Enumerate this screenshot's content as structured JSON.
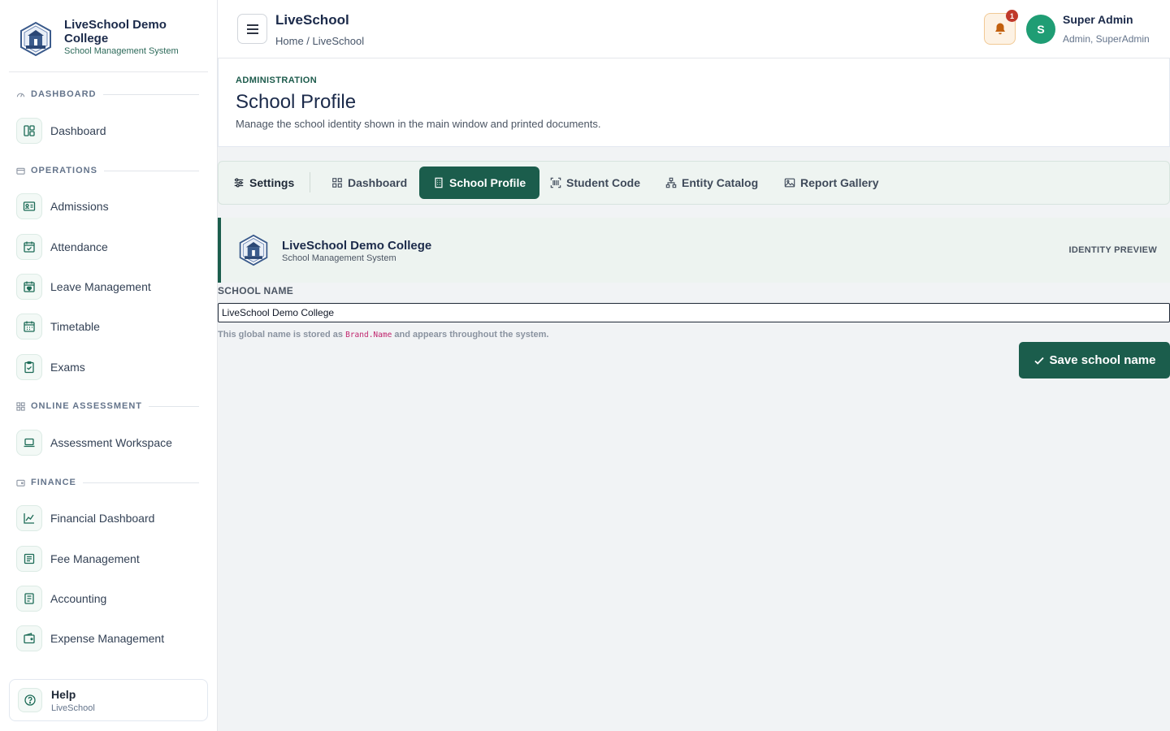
{
  "brand": {
    "name": "LiveSchool Demo College",
    "subtitle": "School Management System"
  },
  "sidebar": {
    "sections": [
      {
        "label": "DASHBOARD",
        "icon": "gauge-icon"
      },
      {
        "label": "OPERATIONS",
        "icon": "folder-icon"
      },
      {
        "label": "ONLINE ASSESSMENT",
        "icon": "grid-icon"
      },
      {
        "label": "FINANCE",
        "icon": "wallet-icon"
      }
    ],
    "items": [
      {
        "label": "Dashboard",
        "icon": "layout-icon"
      },
      {
        "label": "Admissions",
        "icon": "id-card-icon"
      },
      {
        "label": "Attendance",
        "icon": "calendar-check-icon"
      },
      {
        "label": "Leave Management",
        "icon": "calendar-heart-icon"
      },
      {
        "label": "Timetable",
        "icon": "calendar-icon"
      },
      {
        "label": "Exams",
        "icon": "clipboard-check-icon"
      },
      {
        "label": "Assessment Workspace",
        "icon": "laptop-icon"
      },
      {
        "label": "Financial Dashboard",
        "icon": "trend-chart-icon"
      },
      {
        "label": "Fee Management",
        "icon": "receipt-icon"
      },
      {
        "label": "Accounting",
        "icon": "ledger-icon"
      },
      {
        "label": "Expense Management",
        "icon": "wallet-icon"
      }
    ],
    "help": {
      "title": "Help",
      "subtitle": "LiveSchool",
      "icon": "question-circle-icon"
    }
  },
  "topbar": {
    "title": "LiveSchool",
    "breadcrumb": {
      "home": "Home",
      "separator": "/",
      "current": "LiveSchool"
    },
    "notifications_count": "1",
    "user": {
      "initial": "S",
      "name": "Super Admin",
      "role": "Admin, SuperAdmin"
    }
  },
  "header": {
    "eyebrow": "ADMINISTRATION",
    "title": "School Profile",
    "description": "Manage the school identity shown in the main window and printed documents."
  },
  "tabs": [
    {
      "label": "Settings",
      "icon": "sliders-icon"
    },
    {
      "label": "Dashboard",
      "icon": "grid-icon"
    },
    {
      "label": "School Profile",
      "icon": "building-icon",
      "active": true
    },
    {
      "label": "Student Code",
      "icon": "barcode-icon"
    },
    {
      "label": "Entity Catalog",
      "icon": "hierarchy-icon"
    },
    {
      "label": "Report Gallery",
      "icon": "image-icon"
    }
  ],
  "preview": {
    "name": "LiveSchool Demo College",
    "subtitle": "School Management System",
    "tag": "IDENTITY PREVIEW"
  },
  "form": {
    "label": "SCHOOL NAME",
    "value": "LiveSchool Demo College",
    "help_before": "This global name is stored as ",
    "help_code": "Brand.Name",
    "help_after": " and appears throughout the system.",
    "save_label": "Save school name"
  },
  "colors": {
    "accent": "#1b5d4c",
    "avatar": "#1f9d74",
    "bell_bg": "#fdf2e4",
    "badge": "#c0392b"
  }
}
